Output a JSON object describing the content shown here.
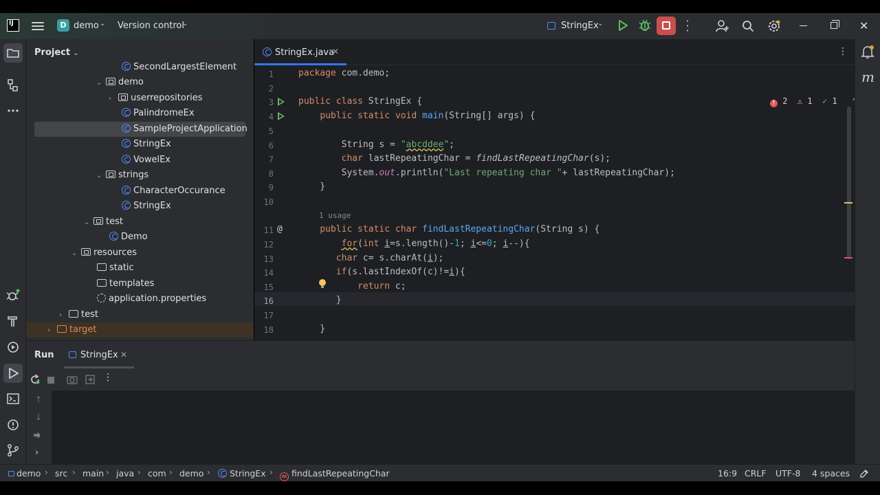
{
  "titlebar": {
    "project_badge": "D",
    "project_name": "demo",
    "vcs_label": "Version control",
    "run_config": "StringEx"
  },
  "project_panel": {
    "title": "Project",
    "tree": [
      {
        "label": "SecondLargestElement",
        "kind": "class"
      },
      {
        "label": "demo",
        "kind": "package",
        "expanded": true
      },
      {
        "label": "userrepositories",
        "kind": "package",
        "expanded": false
      },
      {
        "label": "PalindromeEx",
        "kind": "class"
      },
      {
        "label": "SampleProjectApplication",
        "kind": "class",
        "selected": true
      },
      {
        "label": "StringEx",
        "kind": "class"
      },
      {
        "label": "VowelEx",
        "kind": "class"
      },
      {
        "label": "strings",
        "kind": "package",
        "expanded": true
      },
      {
        "label": "CharacterOccurance",
        "kind": "class"
      },
      {
        "label": "StringEx",
        "kind": "class"
      },
      {
        "label": "test",
        "kind": "package",
        "expanded": true
      },
      {
        "label": "Demo",
        "kind": "class"
      },
      {
        "label": "resources",
        "kind": "folder",
        "expanded": true
      },
      {
        "label": "static",
        "kind": "folder"
      },
      {
        "label": "templates",
        "kind": "folder"
      },
      {
        "label": "application.properties",
        "kind": "settings"
      },
      {
        "label": "test",
        "kind": "folder",
        "expanded": false
      },
      {
        "label": "target",
        "kind": "folder-excluded",
        "expanded": false
      }
    ]
  },
  "editor": {
    "tab_label": "StringEx.java",
    "inspections": {
      "errors": "2",
      "warnings": "1",
      "weak": "1"
    },
    "usage_hint": "1 usage",
    "current_line": "16",
    "line_numbers": [
      "1",
      "2",
      "3",
      "4",
      "5",
      "6",
      "7",
      "8",
      "9",
      "10",
      "11",
      "12",
      "13",
      "14",
      "15",
      "16",
      "17",
      "18"
    ]
  },
  "run_panel": {
    "title": "Run",
    "tab_label": "StringEx"
  },
  "statusbar": {
    "breadcrumbs": [
      "demo",
      "src",
      "main",
      "java",
      "com",
      "demo",
      "StringEx",
      "findLastRepeatingChar"
    ],
    "position": "16:9",
    "line_sep": "CRLF",
    "encoding": "UTF-8",
    "indent": "4 spaces"
  },
  "colors": {
    "accent": "#3574f0",
    "stop": "#c94f4f",
    "run": "#5fb865",
    "keyword": "#cf8e6d",
    "string": "#6aab73",
    "function": "#56a8f5"
  }
}
